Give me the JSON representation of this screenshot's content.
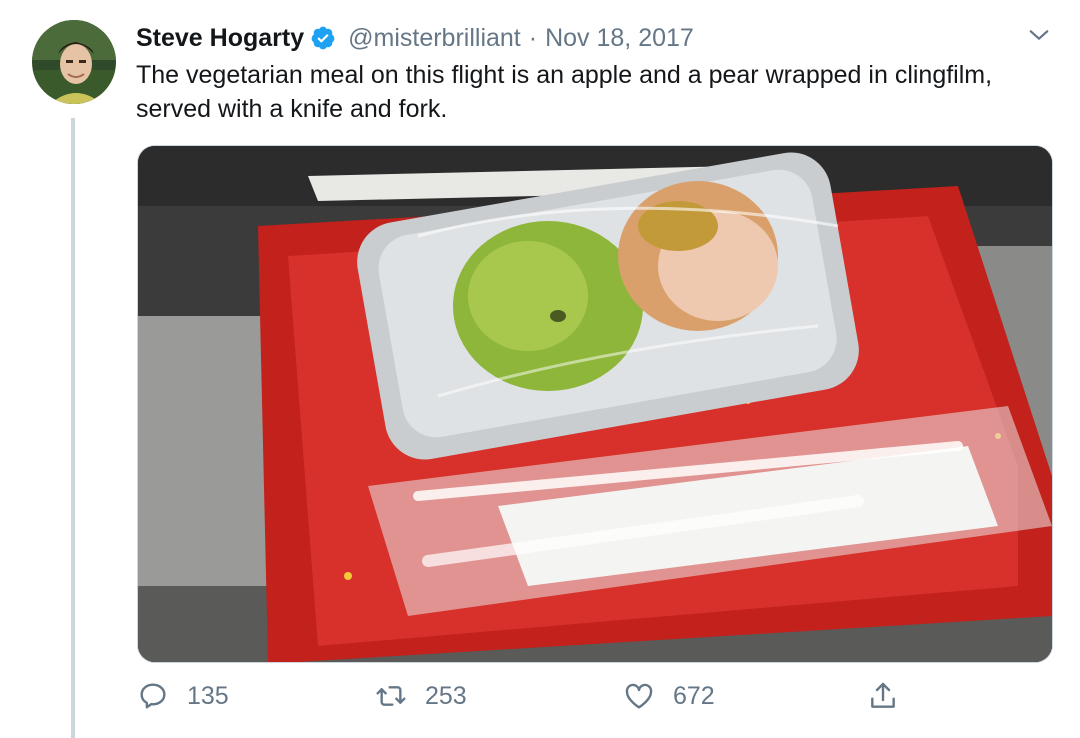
{
  "tweet": {
    "author": {
      "name": "Steve Hogarty",
      "handle": "@misterbrilliant",
      "verified": true
    },
    "date": "Nov 18, 2017",
    "separator": "·",
    "text": "The vegetarian meal on this flight is an apple and a pear wrapped in clingfilm, served with a knife and fork.",
    "media": {
      "depicts": "an apple and a pear wrapped in clingfilm in a foil tray on a red airline tray with plastic cutlery"
    },
    "stats": {
      "replies": "135",
      "retweets": "253",
      "likes": "672"
    }
  },
  "icons": {
    "verified": "verified-badge-icon",
    "menu": "chevron-down-icon",
    "reply": "reply-icon",
    "retweet": "retweet-icon",
    "like": "heart-icon",
    "share": "share-icon"
  },
  "colors": {
    "verified": "#1da1f2",
    "muted": "#657786",
    "thread_line": "#ccd6dd",
    "text": "#14171a"
  }
}
